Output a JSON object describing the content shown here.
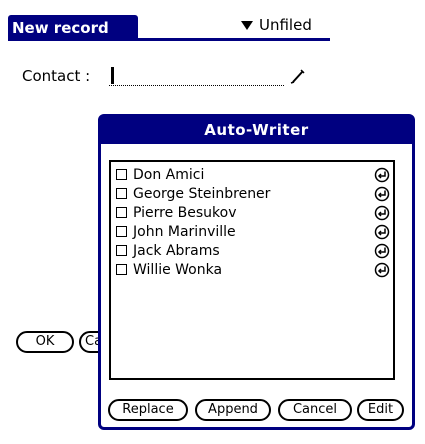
{
  "header": {
    "title": "New record",
    "category_label": "Unfiled"
  },
  "form": {
    "contact_label": "Contact :",
    "contact_value": "",
    "ok_label": "OK",
    "cancel_label_partial": "Ca"
  },
  "popup": {
    "title": "Auto-Writer",
    "items": [
      {
        "label": "Don Amici",
        "checked": false
      },
      {
        "label": "George Steinbrener",
        "checked": false
      },
      {
        "label": "Pierre Besukov",
        "checked": false
      },
      {
        "label": "John Marinville",
        "checked": false
      },
      {
        "label": "Jack Abrams",
        "checked": false
      },
      {
        "label": "Willie Wonka",
        "checked": false
      }
    ],
    "buttons": {
      "replace": "Replace",
      "append": "Append",
      "cancel": "Cancel",
      "edit": "Edit"
    }
  },
  "icons": {
    "category": "triangle-down-icon",
    "field_edit": "pencil-icon",
    "row_action": "insert-arrow-icon"
  },
  "colors": {
    "title_bar": "#000080",
    "background": "#ffffff",
    "text": "#000000"
  }
}
